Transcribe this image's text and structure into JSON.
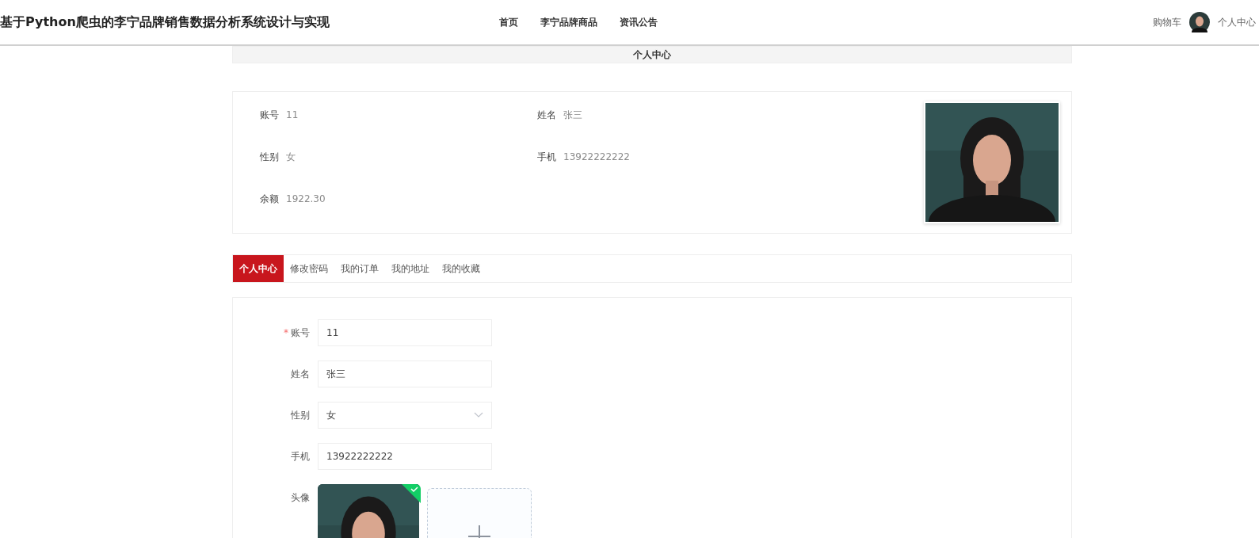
{
  "header": {
    "title": "基于Python爬虫的李宁品牌销售数据分析系统设计与实现",
    "nav": [
      {
        "label": "首页"
      },
      {
        "label": "李宁品牌商品"
      },
      {
        "label": "资讯公告"
      }
    ],
    "cart": "购物车",
    "user_link": "个人中心"
  },
  "page_title": "个人中心",
  "profile": {
    "fields": [
      {
        "label": "账号",
        "value": "11"
      },
      {
        "label": "姓名",
        "value": "张三"
      },
      {
        "label": "性别",
        "value": "女"
      },
      {
        "label": "手机",
        "value": "13922222222"
      },
      {
        "label": "余额",
        "value": "1922.30"
      }
    ]
  },
  "tabs": [
    {
      "label": "个人中心",
      "selected": true
    },
    {
      "label": "修改密码",
      "selected": false
    },
    {
      "label": "我的订单",
      "selected": false
    },
    {
      "label": "我的地址",
      "selected": false
    },
    {
      "label": "我的收藏",
      "selected": false
    }
  ],
  "form": {
    "fields": [
      {
        "kind": "input",
        "mark": "*",
        "label": "账号",
        "value": "11"
      },
      {
        "kind": "input",
        "label": "姓名",
        "value": "张三"
      },
      {
        "kind": "select",
        "label": "性别",
        "value": "女"
      },
      {
        "kind": "input",
        "label": "手机",
        "value": "13922222222"
      },
      {
        "kind": "upload",
        "label": "头像",
        "uploaded": true
      }
    ]
  }
}
